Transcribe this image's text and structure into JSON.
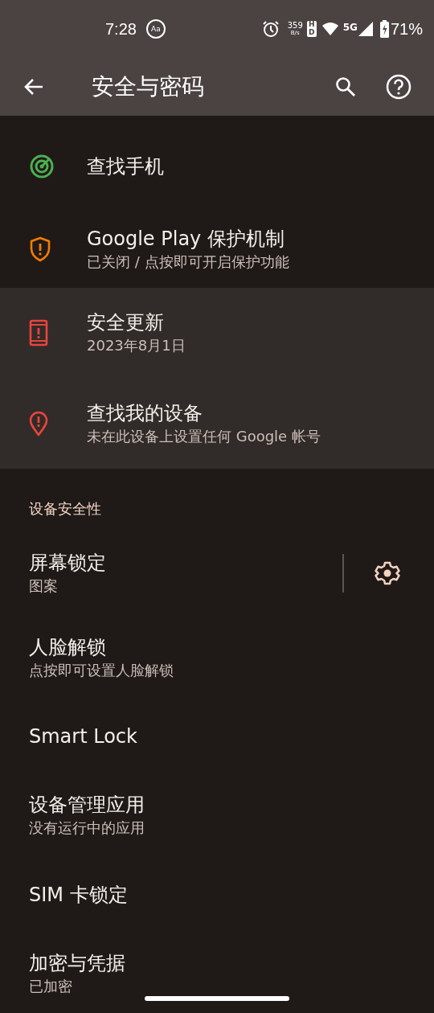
{
  "status_bar": {
    "time": "7:28",
    "text_scale_icon": "Aa",
    "net_speed": "359",
    "net_unit": "B/s",
    "hd": "HD",
    "network": "5G",
    "battery": "71%"
  },
  "app_bar": {
    "title": "安全与密码"
  },
  "status_items": [
    {
      "kind": "radar",
      "color": "#4caf50",
      "title": "查找手机",
      "highlighted": false
    },
    {
      "kind": "shield",
      "color": "#f57c00",
      "title": "Google Play 保护机制",
      "subtitle": "已关闭 / 点按即可开启保护功能",
      "highlighted": false
    },
    {
      "kind": "phone",
      "color": "#e8453c",
      "title": "安全更新",
      "subtitle": "2023年8月1日",
      "highlighted": true
    },
    {
      "kind": "pin",
      "color": "#e8453c",
      "title": "查找我的设备",
      "subtitle": "未在此设备上设置任何 Google 帐号",
      "highlighted": true
    }
  ],
  "section": {
    "title": "设备安全性"
  },
  "settings": [
    {
      "title": "屏幕锁定",
      "subtitle": "图案",
      "settings_button": true
    },
    {
      "title": "人脸解锁",
      "subtitle": "点按即可设置人脸解锁",
      "settings_button": false
    },
    {
      "title": "Smart Lock",
      "settings_button": false
    },
    {
      "title": "设备管理应用",
      "subtitle": "没有运行中的应用",
      "settings_button": false
    },
    {
      "title": "SIM 卡锁定",
      "settings_button": false
    },
    {
      "title": "加密与凭据",
      "subtitle": "已加密",
      "settings_button": false
    }
  ]
}
